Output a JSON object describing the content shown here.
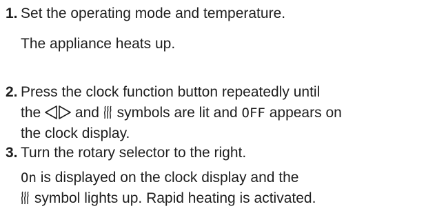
{
  "steps": [
    {
      "number": "1.",
      "text": "Set the operating mode and temperature.",
      "result": "The appliance heats up."
    },
    {
      "number": "2.",
      "line1": "Press the clock function button repeatedly until",
      "line2_pre": "the",
      "line2_mid": "and",
      "line2_post": "symbols are lit and",
      "display_off": "OFF",
      "line2_end": "appears on",
      "line3": "the clock display."
    },
    {
      "number": "3.",
      "text": "Turn the rotary selector to the right.",
      "display_on": "On",
      "result_line1": "is displayed on the clock display and the",
      "result_line2": "symbol lights up. Rapid heating is activated."
    }
  ],
  "icons": {
    "arrows_symbol": "left-right-arrows-icon",
    "heating_symbol": "rapid-heating-icon"
  }
}
